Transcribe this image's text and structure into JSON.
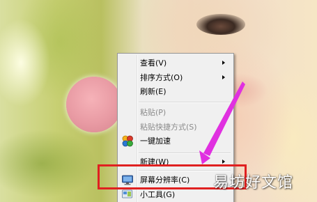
{
  "context_menu": {
    "items": [
      {
        "label": "查看(V)",
        "submenu": true,
        "disabled": false,
        "icon": ""
      },
      {
        "label": "排序方式(O)",
        "submenu": true,
        "disabled": false,
        "icon": ""
      },
      {
        "label": "刷新(E)",
        "submenu": false,
        "disabled": false,
        "icon": ""
      },
      {
        "label": "粘贴(P)",
        "submenu": false,
        "disabled": true,
        "icon": ""
      },
      {
        "label": "粘贴快捷方式(S)",
        "submenu": false,
        "disabled": true,
        "icon": ""
      },
      {
        "label": "一键加速",
        "submenu": false,
        "disabled": false,
        "icon": "accelerator-icon"
      },
      {
        "label": "新建(W)",
        "submenu": true,
        "disabled": false,
        "icon": ""
      },
      {
        "label": "屏幕分辨率(C)",
        "submenu": false,
        "disabled": false,
        "icon": "display-icon"
      },
      {
        "label": "小工具(G)",
        "submenu": false,
        "disabled": false,
        "icon": "gadgets-icon"
      }
    ]
  },
  "annotation": {
    "highlight_color": "#e02020",
    "arrow_color": "#e030e0"
  },
  "watermark": {
    "text": "易坊好文馆"
  }
}
